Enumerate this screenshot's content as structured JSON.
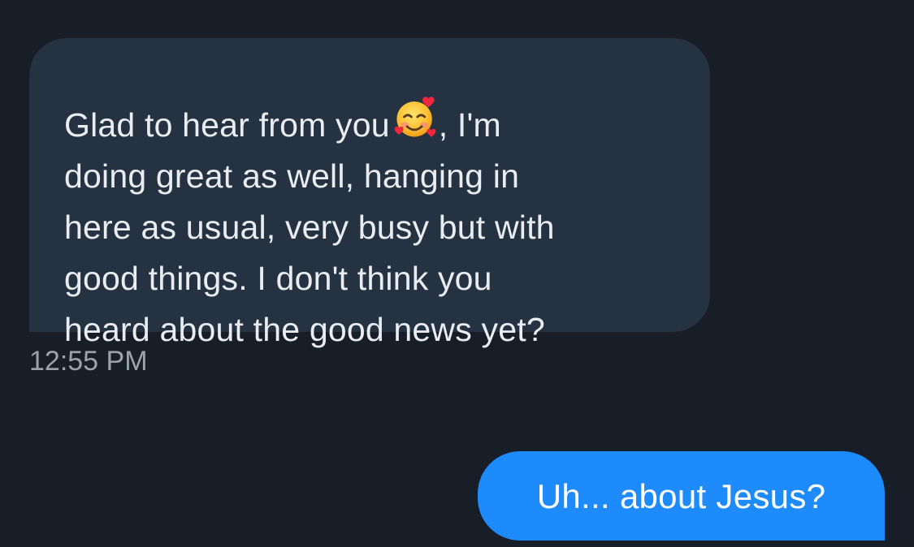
{
  "messages": {
    "incoming": {
      "text_before_emoji": "Glad to hear from you",
      "emoji_icon": "smiling-face-with-hearts-icon",
      "text_after_emoji": ", I'm\ndoing great as well, hanging in\nhere as usual, very busy but with\ngood things. I don't think you\nheard about the good news yet?",
      "timestamp": "12:55 PM"
    },
    "outgoing": {
      "text": "Uh... about Jesus?"
    }
  },
  "colors": {
    "background": "#171e28",
    "incoming_bubble": "#253241",
    "outgoing_bubble": "#1d8bfb",
    "timestamp_text": "#9aa3ad"
  }
}
